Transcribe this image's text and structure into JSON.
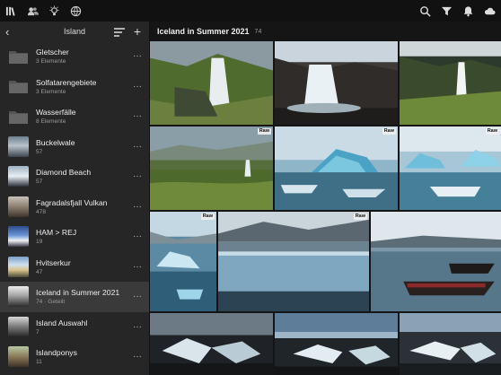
{
  "topbar": {
    "left_icons": [
      "library-icon",
      "people-icon",
      "learn-icon",
      "discover-icon"
    ],
    "right_icons": [
      "search-icon",
      "filter-icon",
      "notifications-icon",
      "cloud-icon"
    ]
  },
  "sidebar": {
    "title": "Island",
    "items": [
      {
        "name": "Gletscher",
        "sub": "3 Elemente",
        "type": "folder"
      },
      {
        "name": "Solfatarengebiete",
        "sub": "3 Elemente",
        "type": "folder"
      },
      {
        "name": "Wasserfälle",
        "sub": "8 Elemente",
        "type": "folder"
      },
      {
        "name": "Buckelwale",
        "sub": "57",
        "type": "album"
      },
      {
        "name": "Diamond Beach",
        "sub": "57",
        "type": "album"
      },
      {
        "name": "Fagradalsfjall Vulkan",
        "sub": "478",
        "type": "album"
      },
      {
        "name": "HAM > REJ",
        "sub": "19",
        "type": "album"
      },
      {
        "name": "Hvitserkur",
        "sub": "47",
        "type": "album"
      },
      {
        "name": "Iceland in Summer 2021",
        "sub": "74 · Geteilt",
        "type": "album",
        "selected": true
      },
      {
        "name": "Island Auswahl",
        "sub": "7",
        "type": "album"
      },
      {
        "name": "Islandponys",
        "sub": "11",
        "type": "album"
      }
    ],
    "more_label": "···"
  },
  "main": {
    "title": "Iceland in Summer 2021",
    "count": "74"
  },
  "photos": {
    "raw_label": "Raw",
    "tiles": [
      {
        "name": "waterfall-green-photo",
        "raw": false
      },
      {
        "name": "waterfall-rocks-photo",
        "raw": false
      },
      {
        "name": "waterfall-gorge-photo",
        "raw": false
      },
      {
        "name": "valley-waterfall-photo",
        "raw": true
      },
      {
        "name": "iceberg-blue-photo",
        "raw": true
      },
      {
        "name": "icebergs-lagoon-photo",
        "raw": true
      },
      {
        "name": "iceberg-small-photo",
        "raw": true
      },
      {
        "name": "glacier-front-photo",
        "raw": true
      },
      {
        "name": "zodiac-boats-photo",
        "raw": false
      },
      {
        "name": "ice-beach-1-photo",
        "raw": false
      },
      {
        "name": "ice-beach-2-photo",
        "raw": false
      },
      {
        "name": "ice-beach-3-photo",
        "raw": false
      }
    ]
  }
}
